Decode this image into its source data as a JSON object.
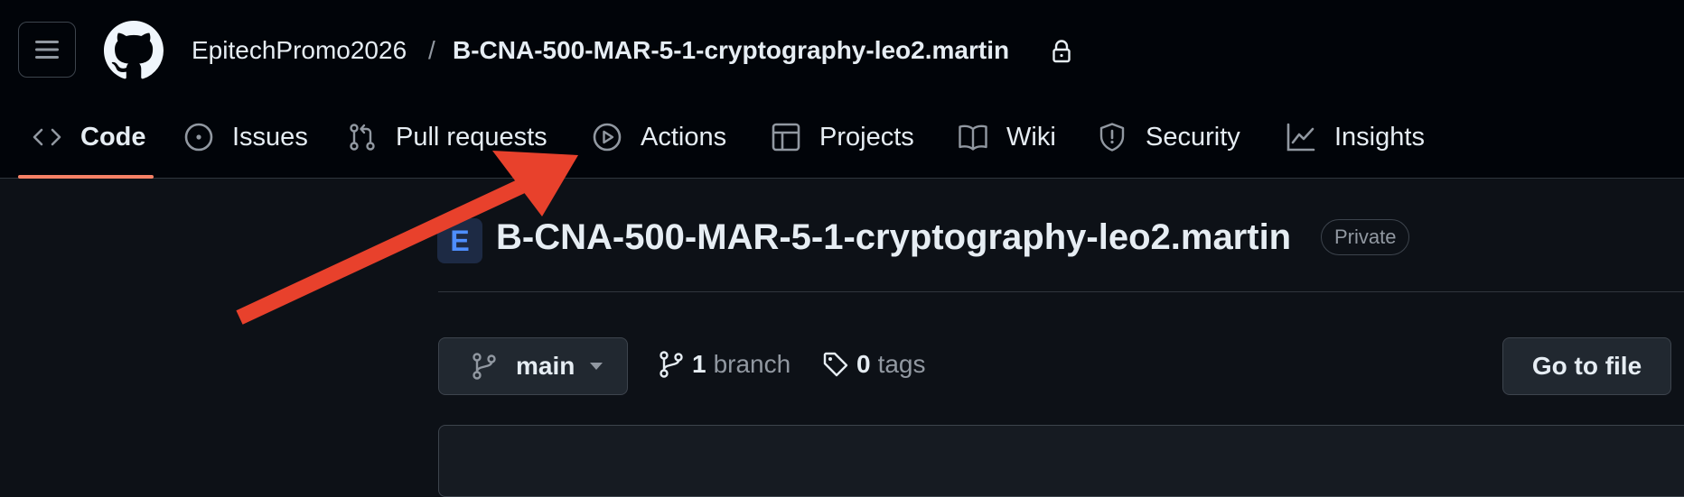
{
  "header": {
    "owner": "EpitechPromo2026",
    "separator": "/",
    "repo": "B-CNA-500-MAR-5-1-cryptography-leo2.martin"
  },
  "tabs": [
    {
      "label": "Code",
      "icon": "code-icon",
      "active": true
    },
    {
      "label": "Issues",
      "icon": "issue-icon"
    },
    {
      "label": "Pull requests",
      "icon": "pull-request-icon"
    },
    {
      "label": "Actions",
      "icon": "play-icon"
    },
    {
      "label": "Projects",
      "icon": "table-icon"
    },
    {
      "label": "Wiki",
      "icon": "book-icon"
    },
    {
      "label": "Security",
      "icon": "shield-icon"
    },
    {
      "label": "Insights",
      "icon": "graph-icon"
    }
  ],
  "repo": {
    "title": "B-CNA-500-MAR-5-1-cryptography-leo2.martin",
    "visibility": "Private",
    "avatar_letter": "E"
  },
  "toolbar": {
    "branch": "main",
    "branch_count": "1",
    "branch_label": "branch",
    "tag_count": "0",
    "tag_label": "tags",
    "goto_label": "Go to file"
  },
  "colors": {
    "background": "#0d1117",
    "header_bg": "#010409",
    "active_underline": "#f78166",
    "annotation_arrow": "#e8412c"
  }
}
